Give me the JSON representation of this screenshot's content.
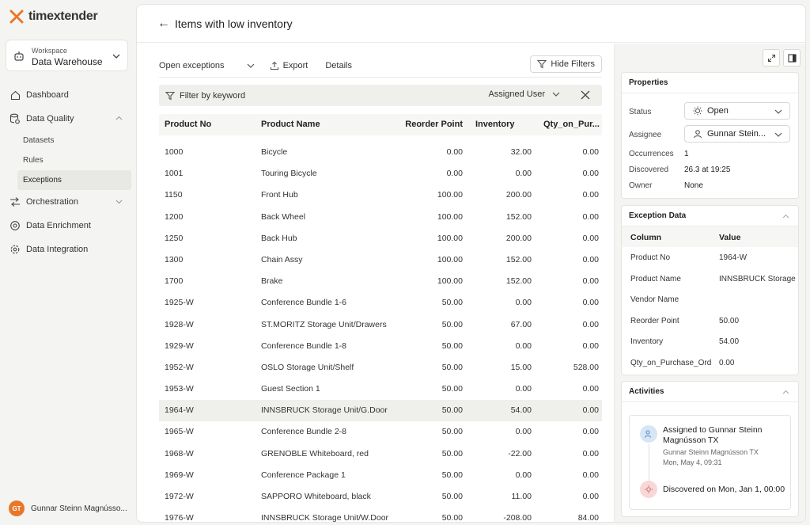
{
  "brand": {
    "name": "timextender",
    "accent": "#e9772a"
  },
  "workspace": {
    "label": "Workspace",
    "name": "Data Warehouse"
  },
  "nav": {
    "dashboard": "Dashboard",
    "data_quality": "Data Quality",
    "dq_sub": [
      "Datasets",
      "Rules",
      "Exceptions"
    ],
    "orchestration": "Orchestration",
    "data_enrichment": "Data Enrichment",
    "data_integration": "Data Integration"
  },
  "user": {
    "initials": "GT",
    "name": "Gunnar Steinn Magnússo..."
  },
  "page": {
    "title": "Items with low inventory"
  },
  "toolbar": {
    "view": "Open exceptions",
    "export": "Export",
    "details": "Details",
    "hide_filters": "Hide Filters"
  },
  "filter": {
    "keyword": "Filter by keyword",
    "assigned_user": "Assigned User"
  },
  "table": {
    "columns": [
      "Product No",
      "Product Name",
      "Reorder Point",
      "Inventory",
      "Qty_on_Pur..."
    ],
    "rows": [
      [
        "1000",
        "Bicycle",
        "0.00",
        "32.00",
        "0.00"
      ],
      [
        "1001",
        "Touring Bicycle",
        "0.00",
        "0.00",
        "0.00"
      ],
      [
        "1150",
        "Front Hub",
        "100.00",
        "200.00",
        "0.00"
      ],
      [
        "1200",
        "Back Wheel",
        "100.00",
        "152.00",
        "0.00"
      ],
      [
        "1250",
        "Back Hub",
        "100.00",
        "200.00",
        "0.00"
      ],
      [
        "1300",
        "Chain Assy",
        "100.00",
        "152.00",
        "0.00"
      ],
      [
        "1700",
        "Brake",
        "100.00",
        "152.00",
        "0.00"
      ],
      [
        "1925-W",
        "Conference Bundle 1-6",
        "50.00",
        "0.00",
        "0.00"
      ],
      [
        "1928-W",
        "ST.MORITZ Storage Unit/Drawers",
        "50.00",
        "67.00",
        "0.00"
      ],
      [
        "1929-W",
        "Conference Bundle 1-8",
        "50.00",
        "0.00",
        "0.00"
      ],
      [
        "1952-W",
        "OSLO Storage Unit/Shelf",
        "50.00",
        "15.00",
        "528.00"
      ],
      [
        "1953-W",
        "Guest Section 1",
        "50.00",
        "0.00",
        "0.00"
      ],
      [
        "1964-W",
        "INNSBRUCK Storage Unit/G.Door",
        "50.00",
        "54.00",
        "0.00"
      ],
      [
        "1965-W",
        "Conference Bundle 2-8",
        "50.00",
        "0.00",
        "0.00"
      ],
      [
        "1968-W",
        "GRENOBLE Whiteboard, red",
        "50.00",
        "-22.00",
        "0.00"
      ],
      [
        "1969-W",
        "Conference Package 1",
        "50.00",
        "0.00",
        "0.00"
      ],
      [
        "1972-W",
        "SAPPORO Whiteboard, black",
        "50.00",
        "11.00",
        "0.00"
      ],
      [
        "1976-W",
        "INNSBRUCK Storage Unit/W.Door",
        "50.00",
        "-208.00",
        "84.00"
      ]
    ],
    "selected_index": 12
  },
  "properties": {
    "title": "Properties",
    "status_label": "Status",
    "status_value": "Open",
    "assignee_label": "Assignee",
    "assignee_value": "Gunnar Stein...",
    "occurrences_label": "Occurrences",
    "occurrences_value": "1",
    "discovered_label": "Discovered",
    "discovered_value": "26.3 at 19:25",
    "owner_label": "Owner",
    "owner_value": "None"
  },
  "exception_data": {
    "title": "Exception Data",
    "col_header": "Column",
    "val_header": "Value",
    "rows": [
      [
        "Product No",
        "1964-W"
      ],
      [
        "Product Name",
        "INNSBRUCK Storage"
      ],
      [
        "Vendor Name",
        ""
      ],
      [
        "Reorder Point",
        "50.00"
      ],
      [
        "Inventory",
        "54.00"
      ],
      [
        "Qty_on_Purchase_Ord",
        "0.00"
      ]
    ]
  },
  "activities": {
    "title": "Activities",
    "items": [
      {
        "title": "Assigned to Gunnar Steinn Magnússon TX",
        "by": "Gunnar Steinn Magnússon TX",
        "time": "Mon, May 4, 09:31"
      },
      {
        "title": "Discovered on Mon, Jan 1, 00:00"
      }
    ]
  }
}
